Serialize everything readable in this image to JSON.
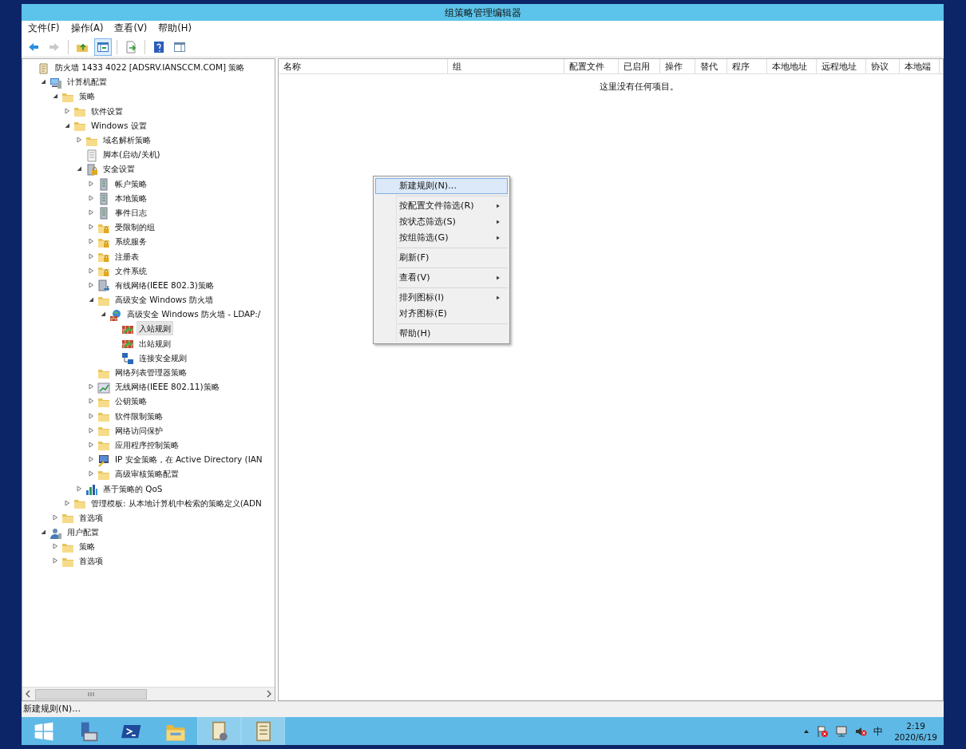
{
  "window": {
    "title": "组策略管理编辑器"
  },
  "menu_bar": [
    {
      "label": "文件(F)"
    },
    {
      "label": "操作(A)"
    },
    {
      "label": "查看(V)"
    },
    {
      "label": "帮助(H)"
    }
  ],
  "toolbar": [
    {
      "kind": "back",
      "disabled": false
    },
    {
      "kind": "forward",
      "disabled": true
    },
    {
      "kind": "sep"
    },
    {
      "kind": "up",
      "disabled": false
    },
    {
      "kind": "tree",
      "disabled": false,
      "selected": true
    },
    {
      "kind": "sep"
    },
    {
      "kind": "export",
      "disabled": false
    },
    {
      "kind": "sep"
    },
    {
      "kind": "help",
      "disabled": false
    },
    {
      "kind": "panel",
      "disabled": false
    }
  ],
  "tree": [
    {
      "label": "防火墙 1433 4022 [ADSRV.IANSCCM.COM] 策略",
      "kind": "scroll",
      "selected": false,
      "children": [
        {
          "label": "计算机配置",
          "kind": "computer",
          "expanded": true,
          "selected": false,
          "children": [
            {
              "label": "策略",
              "kind": "folder",
              "expanded": true,
              "selected": false,
              "children": [
                {
                  "label": "软件设置",
                  "kind": "folder",
                  "expanded": false,
                  "selected": false
                },
                {
                  "label": "Windows 设置",
                  "kind": "folder",
                  "expanded": true,
                  "selected": false,
                  "children": [
                    {
                      "label": "域名解析策略",
                      "kind": "folder",
                      "expanded": false,
                      "selected": false
                    },
                    {
                      "label": "脚本(启动/关机)",
                      "kind": "script",
                      "selected": false
                    },
                    {
                      "label": "安全设置",
                      "kind": "secure",
                      "expanded": true,
                      "selected": false,
                      "children": [
                        {
                          "label": "帐户策略",
                          "kind": "server",
                          "expanded": false,
                          "selected": false
                        },
                        {
                          "label": "本地策略",
                          "kind": "server",
                          "expanded": false,
                          "selected": false
                        },
                        {
                          "label": "事件日志",
                          "kind": "server",
                          "expanded": false,
                          "selected": false
                        },
                        {
                          "label": "受限制的组",
                          "kind": "lockfolder",
                          "expanded": false,
                          "selected": false
                        },
                        {
                          "label": "系统服务",
                          "kind": "lockfolder",
                          "expanded": false,
                          "selected": false
                        },
                        {
                          "label": "注册表",
                          "kind": "lockfolder",
                          "expanded": false,
                          "selected": false
                        },
                        {
                          "label": "文件系统",
                          "kind": "lockfolder",
                          "expanded": false,
                          "selected": false
                        },
                        {
                          "label": "有线网络(IEEE 802.3)策略",
                          "kind": "network",
                          "expanded": false,
                          "selected": false
                        },
                        {
                          "label": "高级安全 Windows 防火墙",
                          "kind": "folder",
                          "expanded": true,
                          "selected": false,
                          "children": [
                            {
                              "label": "高级安全 Windows 防火墙 - LDAP:/",
                              "kind": "firewall",
                              "expanded": true,
                              "selected": false,
                              "children": [
                                {
                                  "label": "入站规则",
                                  "kind": "rule",
                                  "selected": true
                                },
                                {
                                  "label": "出站规则",
                                  "kind": "rule",
                                  "selected": false
                                },
                                {
                                  "label": "连接安全规则",
                                  "kind": "connect",
                                  "selected": false
                                }
                              ]
                            }
                          ]
                        },
                        {
                          "label": "网络列表管理器策略",
                          "kind": "folder",
                          "selected": false
                        },
                        {
                          "label": "无线网络(IEEE 802.11)策略",
                          "kind": "wifi",
                          "expanded": false,
                          "selected": false
                        },
                        {
                          "label": "公钥策略",
                          "kind": "folder",
                          "expanded": false,
                          "selected": false
                        },
                        {
                          "label": "软件限制策略",
                          "kind": "folder",
                          "expanded": false,
                          "selected": false
                        },
                        {
                          "label": "网络访问保护",
                          "kind": "folder",
                          "expanded": false,
                          "selected": false
                        },
                        {
                          "label": "应用程序控制策略",
                          "kind": "folder",
                          "expanded": false,
                          "selected": false
                        },
                        {
                          "label": "IP 安全策略，在 Active Directory (IAN",
                          "kind": "ipsec",
                          "expanded": false,
                          "selected": false
                        },
                        {
                          "label": "高级审核策略配置",
                          "kind": "folder",
                          "expanded": false,
                          "selected": false
                        }
                      ]
                    },
                    {
                      "label": "基于策略的 QoS",
                      "kind": "chart",
                      "expanded": false,
                      "selected": false
                    }
                  ]
                },
                {
                  "label": "管理模板: 从本地计算机中检索的策略定义(ADN",
                  "kind": "folder",
                  "expanded": false,
                  "selected": false
                }
              ]
            },
            {
              "label": "首选项",
              "kind": "folder",
              "expanded": false,
              "selected": false
            }
          ]
        },
        {
          "label": "用户配置",
          "kind": "user",
          "expanded": true,
          "selected": false,
          "children": [
            {
              "label": "策略",
              "kind": "folder",
              "expanded": false,
              "selected": false
            },
            {
              "label": "首选项",
              "kind": "folder",
              "expanded": false,
              "selected": false
            }
          ]
        }
      ]
    }
  ],
  "list": {
    "columns": [
      "名称",
      "组",
      "配置文件",
      "已启用",
      "操作",
      "替代",
      "程序",
      "本地地址",
      "远程地址",
      "协议",
      "本地端"
    ],
    "empty_message": "这里没有任何项目。"
  },
  "context_menu": [
    {
      "kind": "item",
      "label": "新建规则(N)...",
      "submenu": false,
      "selected": true
    },
    {
      "kind": "separator"
    },
    {
      "kind": "item",
      "label": "按配置文件筛选(R)",
      "submenu": true,
      "selected": false
    },
    {
      "kind": "item",
      "label": "按状态筛选(S)",
      "submenu": true,
      "selected": false
    },
    {
      "kind": "item",
      "label": "按组筛选(G)",
      "submenu": true,
      "selected": false
    },
    {
      "kind": "separator"
    },
    {
      "kind": "item",
      "label": "刷新(F)",
      "submenu": false,
      "selected": false
    },
    {
      "kind": "separator"
    },
    {
      "kind": "item",
      "label": "查看(V)",
      "submenu": true,
      "selected": false
    },
    {
      "kind": "separator"
    },
    {
      "kind": "item",
      "label": "排列图标(I)",
      "submenu": true,
      "selected": false
    },
    {
      "kind": "item",
      "label": "对齐图标(E)",
      "submenu": false,
      "selected": false
    },
    {
      "kind": "separator"
    },
    {
      "kind": "item",
      "label": "帮助(H)",
      "submenu": false,
      "selected": false
    }
  ],
  "status_bar": "新建规则(N)...",
  "taskbar": {
    "apps": [
      {
        "kind": "start",
        "active": false
      },
      {
        "kind": "server",
        "active": false
      },
      {
        "kind": "shell",
        "active": false
      },
      {
        "kind": "explorer",
        "active": false
      },
      {
        "kind": "policy",
        "active": true
      },
      {
        "kind": "scroll",
        "active": true
      }
    ],
    "tray": {
      "ime": "中",
      "time": "2:19",
      "date": "2020/6/19"
    }
  }
}
